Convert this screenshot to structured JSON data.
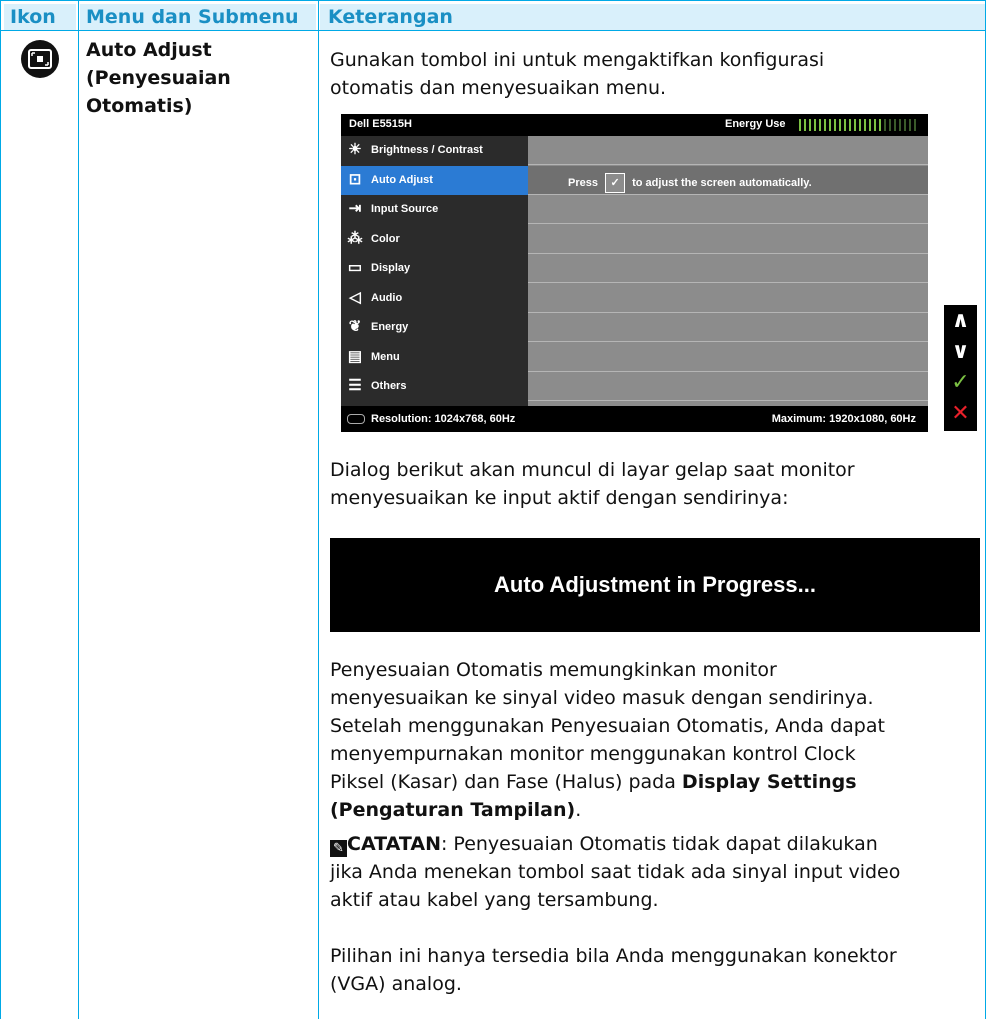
{
  "table": {
    "headers": [
      "Ikon",
      "Menu dan Submenu",
      "Keterangan"
    ],
    "menu_title": [
      "Auto Adjust",
      "(Penyesuaian",
      "Otomatis)"
    ],
    "desc1": [
      "Gunakan tombol ini untuk mengaktifkan konfigurasi",
      "otomatis dan menyesuaikan menu."
    ],
    "desc2": [
      "Dialog berikut akan muncul di layar gelap saat monitor",
      "menyesuaikan ke input aktif dengan sendirinya:"
    ],
    "progress_text": "Auto Adjustment in Progress...",
    "desc3": [
      "Penyesuaian Otomatis memungkinkan monitor",
      "menyesuaikan ke sinyal video masuk dengan sendirinya.",
      "Setelah menggunakan Penyesuaian Otomatis, Anda dapat",
      "menyempurnakan monitor menggunakan kontrol Clock",
      "Piksel (Kasar) dan Fase (Halus) pada "
    ],
    "desc3_bold_a": "Display Settings",
    "desc3_bold_b": "(Pengaturan Tampilan)",
    "desc3_end": ".",
    "note_label": "CATATAN",
    "note_lines": [
      ": Penyesuaian Otomatis tidak dapat dilakukan",
      "jika Anda menekan tombol saat tidak ada sinyal input video",
      "aktif atau kabel yang tersambung."
    ],
    "option_lines": [
      "Pilihan ini hanya tersedia bila Anda menggunakan konektor",
      "(VGA) analog."
    ]
  },
  "osd": {
    "model": "Dell E5515H",
    "energy_label": "Energy Use",
    "energy_level_fraction": 0.72,
    "press_text": "Press",
    "press_suffix": "to adjust the screen automatically.",
    "resolution": "Resolution: 1024x768, 60Hz",
    "maximum": "Maximum: 1920x1080, 60Hz",
    "menu_items": [
      {
        "label": "Brightness / Contrast",
        "icon": "brightness-icon"
      },
      {
        "label": "Auto Adjust",
        "icon": "auto-adjust-icon",
        "selected": true
      },
      {
        "label": "Input Source",
        "icon": "input-source-icon"
      },
      {
        "label": "Color",
        "icon": "color-icon"
      },
      {
        "label": "Display",
        "icon": "display-icon"
      },
      {
        "label": "Audio",
        "icon": "audio-icon"
      },
      {
        "label": "Energy",
        "icon": "energy-icon"
      },
      {
        "label": "Menu",
        "icon": "menu-icon"
      },
      {
        "label": "Others",
        "icon": "others-icon"
      }
    ]
  },
  "nav_buttons": [
    "up-arrow-icon",
    "down-arrow-icon",
    "check-icon",
    "close-icon"
  ],
  "colors": {
    "accent": "#00a9e6",
    "header_bg": "#d9f0fb",
    "selected": "#2b7bd4",
    "check": "#7bc043",
    "close": "#e8202a"
  }
}
